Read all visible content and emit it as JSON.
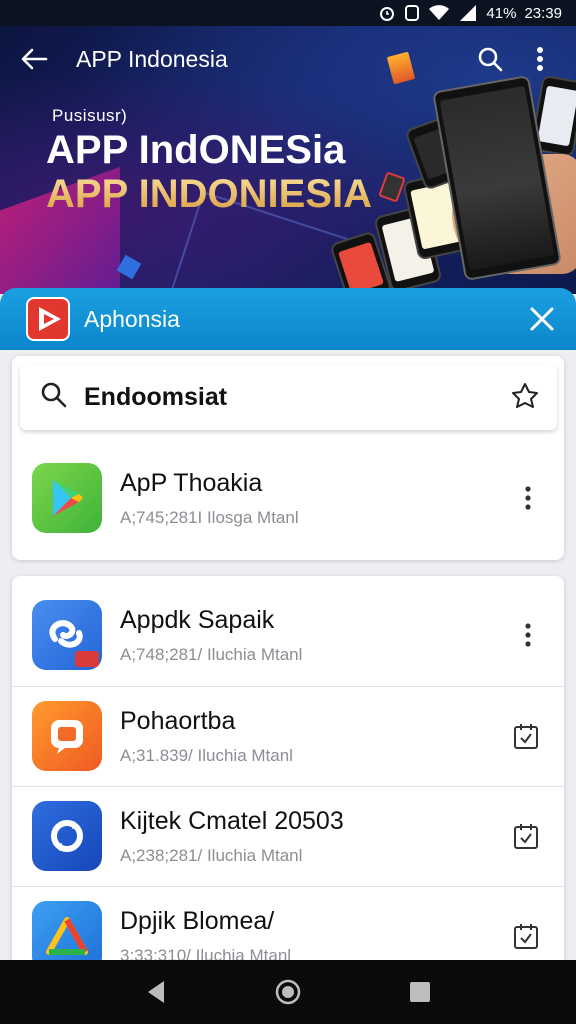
{
  "status_bar": {
    "battery_percent": "41%",
    "time": "23:39"
  },
  "header": {
    "title": "APP Indonesia"
  },
  "promo": {
    "subtitle": "Pusisusr)",
    "line1": "APP IndONESia",
    "line2": "APP INDONIESIA"
  },
  "app_header": {
    "name": "Aphonsia"
  },
  "search": {
    "query": "Endoomsiat"
  },
  "featured": {
    "name": "ApP Thoakia",
    "meta": "A;745;281I Ilosga Mtanl"
  },
  "apps": [
    {
      "name": "Appdk Sapaik",
      "meta": "A;748;281/ Iluchia Mtanl",
      "action": "more"
    },
    {
      "name": "Pohaortba",
      "meta": "A;31.839/ Iluchia Mtanl",
      "action": "calendar"
    },
    {
      "name": "Kijtek Cmatel 20503",
      "meta": "A;238;281/ Iluchia Mtanl",
      "action": "calendar"
    },
    {
      "name": "Dpjik Blomea/",
      "meta": "3;33;310/ Iluchia Mtanl",
      "action": "calendar"
    }
  ],
  "colors": {
    "accent": "#0c86cc",
    "banner": "#17236a",
    "gold": "#e0a94a"
  }
}
